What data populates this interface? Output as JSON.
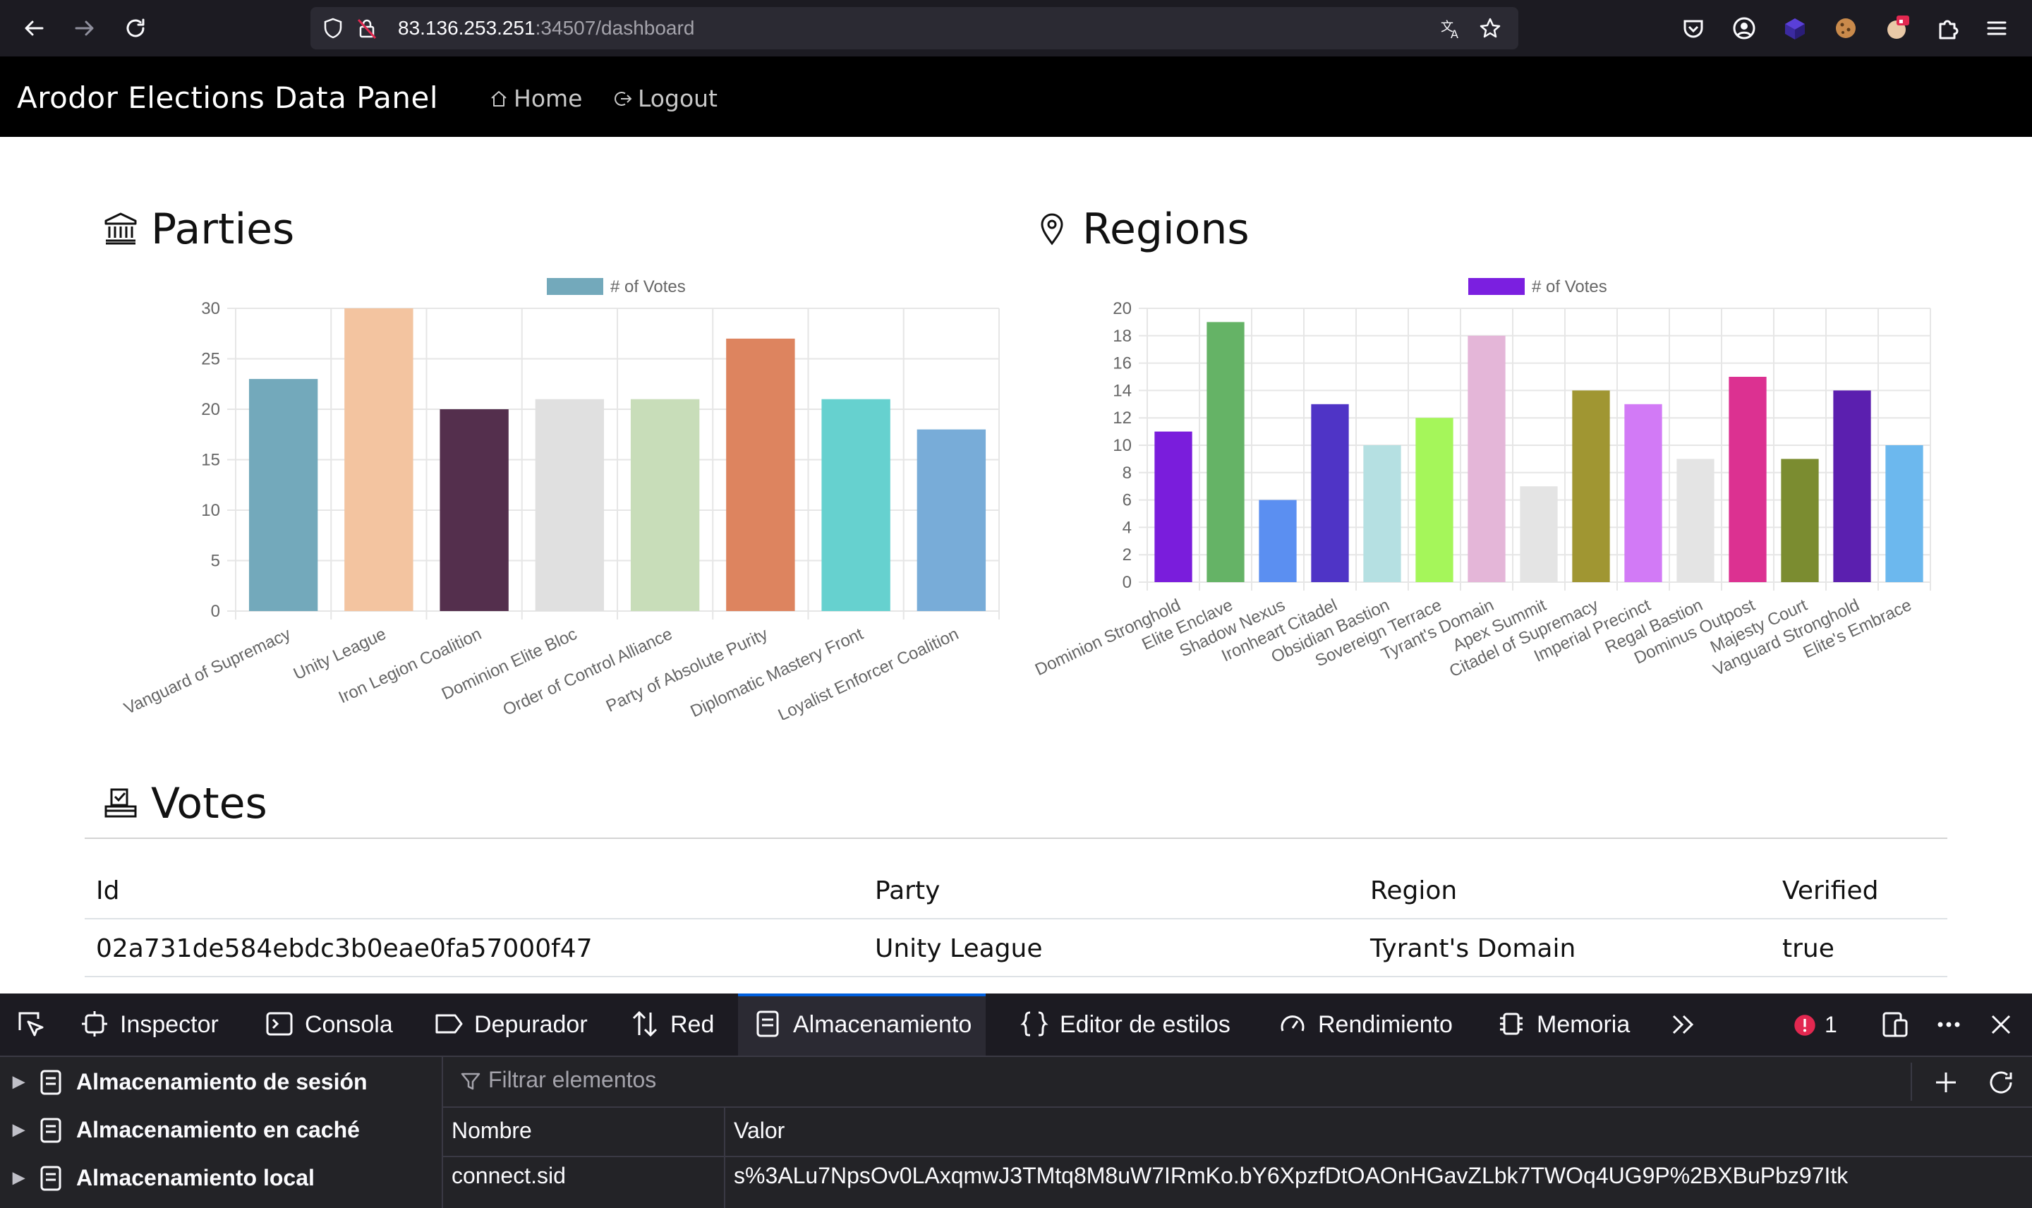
{
  "browser": {
    "url_host": "83.136.253.251",
    "url_rest": ":34507/dashboard"
  },
  "navbar": {
    "brand": "Arodor Elections Data Panel",
    "home_label": "Home",
    "logout_label": "Logout"
  },
  "parties": {
    "heading": "Parties",
    "legend": "# of Votes",
    "color": "#73a9bb"
  },
  "regions": {
    "heading": "Regions",
    "legend": "# of Votes",
    "color": "#7b1fe0"
  },
  "chart_data": [
    {
      "type": "bar",
      "title": "",
      "legend": "# of Votes",
      "categories": [
        "Vanguard of Supremacy",
        "Unity League",
        "Iron Legion Coalition",
        "Dominion Elite Bloc",
        "Order of Control Alliance",
        "Party of Absolute Purity",
        "Diplomatic Mastery Front",
        "Loyalist Enforcer Coalition"
      ],
      "values": [
        23,
        30,
        20,
        21,
        21,
        27,
        21,
        18
      ],
      "colors": [
        "#73a9bb",
        "#f3c4a0",
        "#542f4d",
        "#e0e0e0",
        "#c8ddb9",
        "#dd845f",
        "#66d1cf",
        "#78acd8"
      ],
      "ylim": [
        0,
        30
      ],
      "yticks": [
        0,
        5,
        10,
        15,
        20,
        25,
        30
      ],
      "legend_position": "top",
      "grid": true
    },
    {
      "type": "bar",
      "title": "",
      "legend": "# of Votes",
      "categories": [
        "Dominion Stronghold",
        "Elite Enclave",
        "Shadow Nexus",
        "Ironheart Citadel",
        "Obsidian Bastion",
        "Sovereign Terrace",
        "Tyrant's Domain",
        "Apex Summit",
        "Citadel of Supremacy",
        "Imperial Precinct",
        "Regal Bastion",
        "Dominus Outpost",
        "Majesty Court",
        "Vanguard Stronghold",
        "Elite's Embrace"
      ],
      "values": [
        11,
        19,
        6,
        13,
        10,
        12,
        18,
        7,
        14,
        13,
        9,
        15,
        9,
        14,
        10
      ],
      "colors": [
        "#7a1ddc",
        "#65b366",
        "#5b8ff1",
        "#4f34c6",
        "#b5e0e2",
        "#a5f65a",
        "#e4b6d8",
        "#e4e4e4",
        "#a09632",
        "#d27af6",
        "#e4e4e4",
        "#dc3191",
        "#7b8c30",
        "#5b1faf",
        "#6cb8ee"
      ],
      "ylim": [
        0,
        20
      ],
      "yticks": [
        0,
        2,
        4,
        6,
        8,
        10,
        12,
        14,
        16,
        18,
        20
      ],
      "legend_position": "top",
      "grid": true
    }
  ],
  "votes": {
    "heading": "Votes",
    "columns": [
      "Id",
      "Party",
      "Region",
      "Verified"
    ],
    "rows": [
      [
        "02a731de584ebdc3b0eae0fa57000f47",
        "Unity League",
        "Tyrant's Domain",
        "true"
      ]
    ]
  },
  "devtools": {
    "tabs": [
      "Inspector",
      "Consola",
      "Depurador",
      "Red",
      "Almacenamiento",
      "Editor de estilos",
      "Rendimiento",
      "Memoria"
    ],
    "active_tab": "Almacenamiento",
    "error_count": "1",
    "sidebar": [
      "Almacenamiento de sesión",
      "Almacenamiento en caché",
      "Almacenamiento local"
    ],
    "filter_placeholder": "Filtrar elementos",
    "columns": [
      "Nombre",
      "Valor"
    ],
    "rows": [
      [
        "connect.sid",
        "s%3ALu7NpsOv0LAxqmwJ3TMtq8M8uW7IRmKo.bY6XpzfDtOAOnHGavZLbk7TWOq4UG9P%2BXBuPbz97Itk"
      ]
    ]
  }
}
